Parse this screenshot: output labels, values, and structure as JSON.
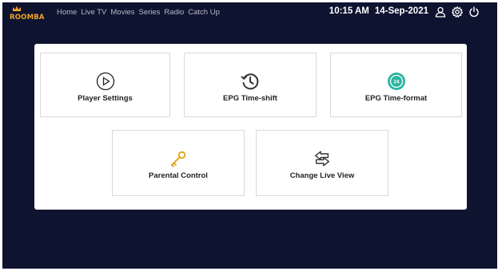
{
  "header": {
    "logo": "ROOMBA",
    "nav": [
      "Home",
      "Live TV",
      "Movies",
      "Series",
      "Radio",
      "Catch Up"
    ],
    "time": "10:15 AM",
    "date": "14-Sep-2021",
    "icons": [
      "user-icon",
      "gear-icon",
      "power-icon"
    ]
  },
  "settings": {
    "cards": [
      {
        "label": "Player Settings",
        "icon": "play-circle-icon"
      },
      {
        "label": "EPG Time-shift",
        "icon": "history-icon"
      },
      {
        "label": "EPG Time-format",
        "icon": "24-hour-icon",
        "badge": "24"
      },
      {
        "label": "Parental Control",
        "icon": "key-icon"
      },
      {
        "label": "Change Live View",
        "icon": "swap-arrows-icon"
      }
    ]
  },
  "colors": {
    "background": "#0e1330",
    "brand": "#f2a324",
    "badge": "#2bb5a0"
  }
}
